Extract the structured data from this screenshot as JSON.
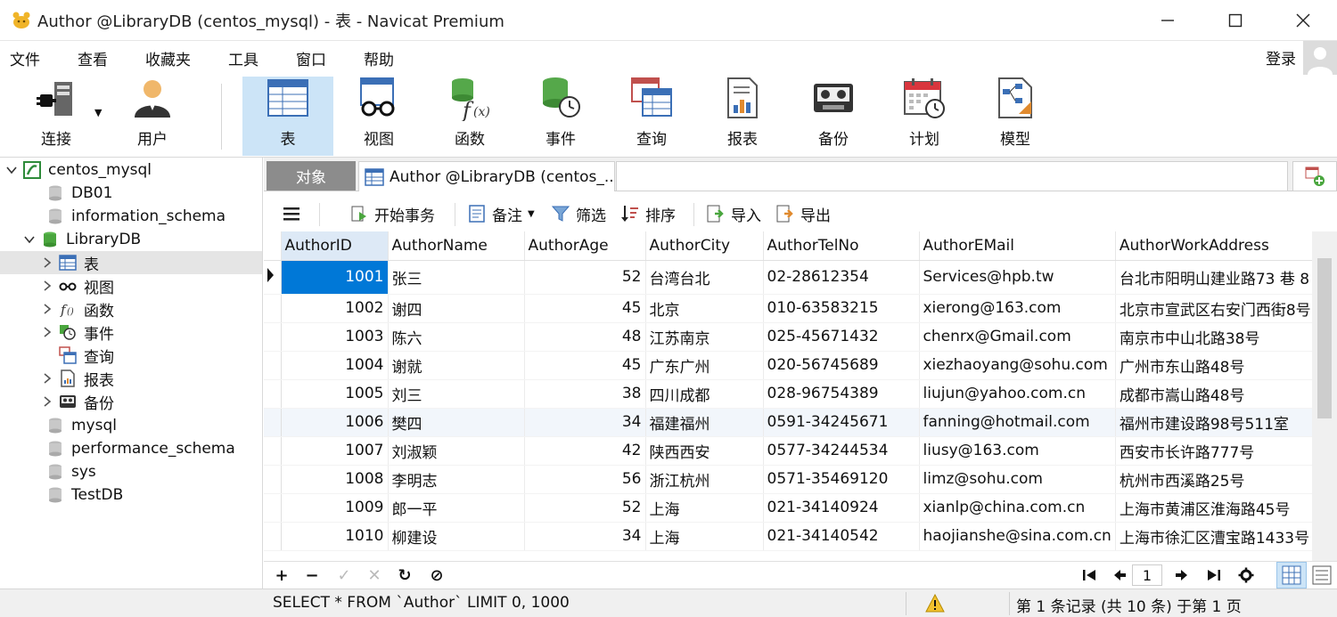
{
  "window": {
    "title": "Author @LibraryDB (centos_mysql) - 表 - Navicat Premium"
  },
  "menu": {
    "items": [
      "文件",
      "查看",
      "收藏夹",
      "工具",
      "窗口",
      "帮助"
    ],
    "login_label": "登录"
  },
  "toolbar": {
    "connect_label": "连接",
    "user_label": "用户",
    "table_label": "表",
    "view_label": "视图",
    "function_label": "函数",
    "event_label": "事件",
    "query_label": "查询",
    "report_label": "报表",
    "backup_label": "备份",
    "schedule_label": "计划",
    "model_label": "模型"
  },
  "sidebar": {
    "connection": "centos_mysql",
    "databases_before": [
      "DB01",
      "information_schema"
    ],
    "active_db": "LibraryDB",
    "children": {
      "tables": "表",
      "views": "视图",
      "functions": "函数",
      "events": "事件",
      "queries": "查询",
      "reports": "报表",
      "backups": "备份"
    },
    "databases_after": [
      "mysql",
      "performance_schema",
      "sys",
      "TestDB"
    ]
  },
  "tabs": {
    "objects_label": "对象",
    "author_tab_label": "Author @LibraryDB (centos_..."
  },
  "grid_toolbar": {
    "begin_transaction": "开始事务",
    "memo": "备注",
    "filter": "筛选",
    "sort": "排序",
    "import": "导入",
    "export": "导出"
  },
  "table": {
    "columns": [
      "AuthorID",
      "AuthorName",
      "AuthorAge",
      "AuthorCity",
      "AuthorTelNo",
      "AuthorEMail",
      "AuthorWorkAddress"
    ],
    "rows": [
      [
        "1001",
        "张三",
        "52",
        "台湾台北",
        "02-28612354",
        "Services@hpb.tw",
        "台北市阳明山建业路73 巷 8"
      ],
      [
        "1002",
        "谢四",
        "45",
        "北京",
        "010-63583215",
        "xierong@163.com",
        "北京市宣武区右安门西街8号"
      ],
      [
        "1003",
        "陈六",
        "48",
        "江苏南京",
        "025-45671432",
        "chenrx@Gmail.com",
        "南京市中山北路38号"
      ],
      [
        "1004",
        "谢就",
        "45",
        "广东广州",
        "020-56745689",
        "xiezhaoyang@sohu.com",
        "广州市东山路48号"
      ],
      [
        "1005",
        "刘三",
        "38",
        "四川成都",
        "028-96754389",
        "liujun@yahoo.com.cn",
        "成都市嵩山路48号"
      ],
      [
        "1006",
        "樊四",
        "34",
        "福建福州",
        "0591-34245671",
        "fanning@hotmail.com",
        "福州市建设路98号511室"
      ],
      [
        "1007",
        "刘淑颖",
        "42",
        "陕西西安",
        "0577-34244534",
        "liusy@163.com",
        "西安市长许路777号"
      ],
      [
        "1008",
        "李明志",
        "56",
        "浙江杭州",
        "0571-35469120",
        "limz@sohu.com",
        "杭州市西溪路25号"
      ],
      [
        "1009",
        "郎一平",
        "52",
        "上海",
        "021-34140924",
        "xianlp@china.com.cn",
        "上海市黄浦区淮海路45号"
      ],
      [
        "1010",
        "柳建设",
        "34",
        "上海",
        "021-34140542",
        "haojianshe@sina.com.cn",
        "上海市徐汇区漕宝路1433号"
      ]
    ]
  },
  "pagination": {
    "page": "1"
  },
  "status": {
    "sql": "SELECT * FROM `Author` LIMIT 0, 1000",
    "record_info": "第 1 条记录 (共 10 条) 于第 1 页"
  },
  "colors": {
    "accent": "#0078d7",
    "selected_tool": "#cce4f7",
    "objects_tab": "#8c8c8c"
  }
}
